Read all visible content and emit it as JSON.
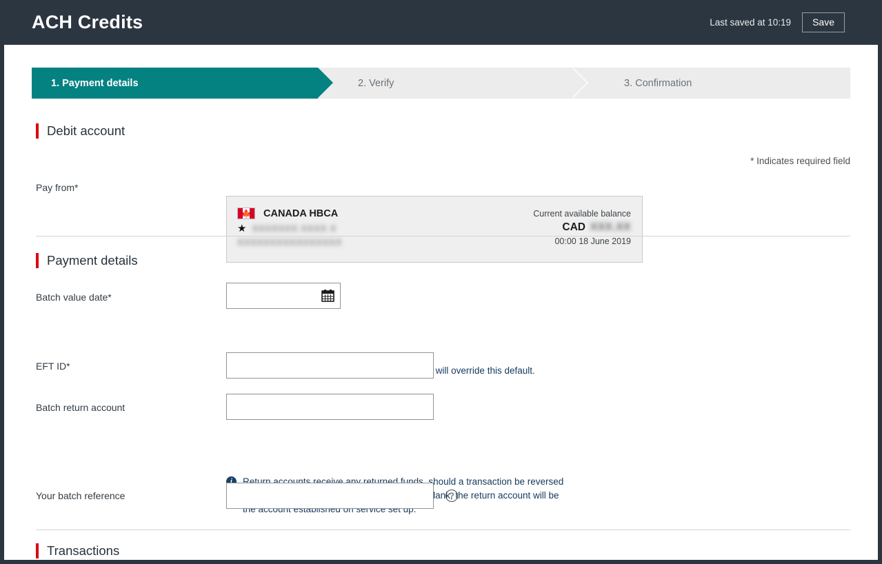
{
  "header": {
    "title": "ACH Credits",
    "last_saved": "Last saved at 10:19",
    "save_label": "Save"
  },
  "stepper": {
    "steps": [
      {
        "label": "1. Payment details",
        "state": "active"
      },
      {
        "label": "2. Verify",
        "state": "upcoming"
      },
      {
        "label": "3. Confirmation",
        "state": "upcoming"
      }
    ],
    "active_color": "#048281",
    "inactive_bg": "#ececec"
  },
  "required_note": "* Indicates required field",
  "debit_account": {
    "section_title": "Debit account",
    "pay_from_label": "Pay from*",
    "card": {
      "country_flag": "canada-flag-icon",
      "account_title": "CANADA HBCA",
      "favorite_icon": "star-icon",
      "account_name_masked": "XXXXXXX XXXX X",
      "account_number_masked": "XXXXXXXXXXXXXXXX",
      "balance_label": "Current available balance",
      "currency": "CAD",
      "balance_masked": "XXX.XX",
      "balance_timestamp": "00:00 18 June 2019"
    }
  },
  "payment_details": {
    "section_title": "Payment details",
    "batch_value_date": {
      "label": "Batch value date*",
      "value": "",
      "placeholder": "",
      "icon": "calendar-icon",
      "note": "Value dates entered for individual transactions will override this default."
    },
    "eft_id": {
      "label": "EFT ID*",
      "value": "",
      "placeholder": ""
    },
    "batch_return_account": {
      "label": "Batch return account",
      "value": "",
      "placeholder": "",
      "note": "Return accounts receive any returned funds, should a transaction be reversed or fail to reach the beneficiary account. If left blank, the return account will be the account established on service set up."
    },
    "batch_reference": {
      "label": "Your batch reference",
      "value": "",
      "placeholder": "",
      "help_icon": "question-mark-icon",
      "help_glyph": "?"
    }
  },
  "transactions": {
    "section_title": "Transactions"
  },
  "colors": {
    "brand_red": "#db0011",
    "teal": "#048281",
    "header_navy": "#2b3640",
    "info_navy": "#1b3f66"
  }
}
